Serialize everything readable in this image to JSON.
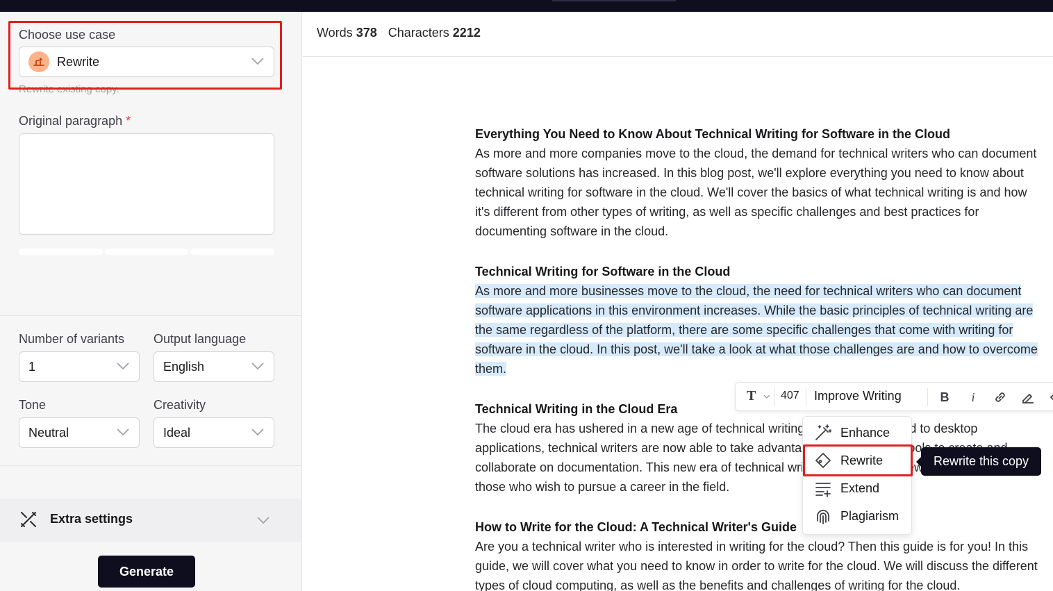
{
  "sidebar": {
    "use_case_label": "Choose use case",
    "use_case_value": "Rewrite",
    "use_case_hint": "Rewrite existing copy.",
    "original_label": "Original paragraph",
    "required_mark": "*",
    "variants_label": "Number of variants",
    "variants_value": "1",
    "language_label": "Output language",
    "language_value": "English",
    "tone_label": "Tone",
    "tone_value": "Neutral",
    "creativity_label": "Creativity",
    "creativity_value": "Ideal",
    "extra_settings_label": "Extra settings",
    "generate_label": "Generate"
  },
  "editor": {
    "words_label": "Words",
    "words_value": "378",
    "chars_label": "Characters",
    "chars_value": "2212",
    "sections": [
      {
        "heading": "Everything You Need to Know About Technical Writing for Software in the Cloud",
        "body": "As more and more companies move to the cloud, the demand for technical writers who can document software solutions has increased. In this blog post, we'll explore everything you need to know about technical writing for software in the cloud. We'll cover the basics of what technical writing is and how it's different from other types of writing, as well as specific challenges and best practices for documenting software in the cloud."
      },
      {
        "heading": "Technical Writing for Software in the Cloud",
        "body": "As more and more businesses move to the cloud, the need for technical writers who can document software applications in this environment increases. While the basic principles of technical writing are the same regardless of the platform, there are some specific challenges that come with writing for software in the cloud. In this post, we'll take a look at what those challenges are and how to overcome them."
      },
      {
        "heading": "Technical Writing in the Cloud Era",
        "body": "The cloud era has ushered in a new age of technical writing. No longer confined to desktop applications, technical writers are now able to take advantage of cloud-based tools to create and collaborate on documentation. This new era of technical writing brings with it new opportunities for those who wish to pursue a career in the field."
      },
      {
        "heading": "How to Write for the Cloud: A Technical Writer's Guide",
        "body": "Are you a technical writer who is interested in writing for the cloud? Then this guide is for you! In this guide, we will cover what you need to know in order to write for the cloud. We will discuss the different types of cloud computing, as well as the benefits and challenges of writing for the cloud."
      }
    ]
  },
  "toolbar": {
    "text_style": "T",
    "selection_count": "407",
    "improve_label": "Improve Writing"
  },
  "menu": {
    "items": [
      "Enhance",
      "Rewrite",
      "Extend",
      "Plagiarism"
    ],
    "tooltip": "Rewrite this copy"
  },
  "colors": {
    "accent_dark": "#0e0e1f",
    "selection": "#d6eafb",
    "annotation_red": "#e01e1e",
    "use_case_icon_bg": "#fdb38a"
  }
}
